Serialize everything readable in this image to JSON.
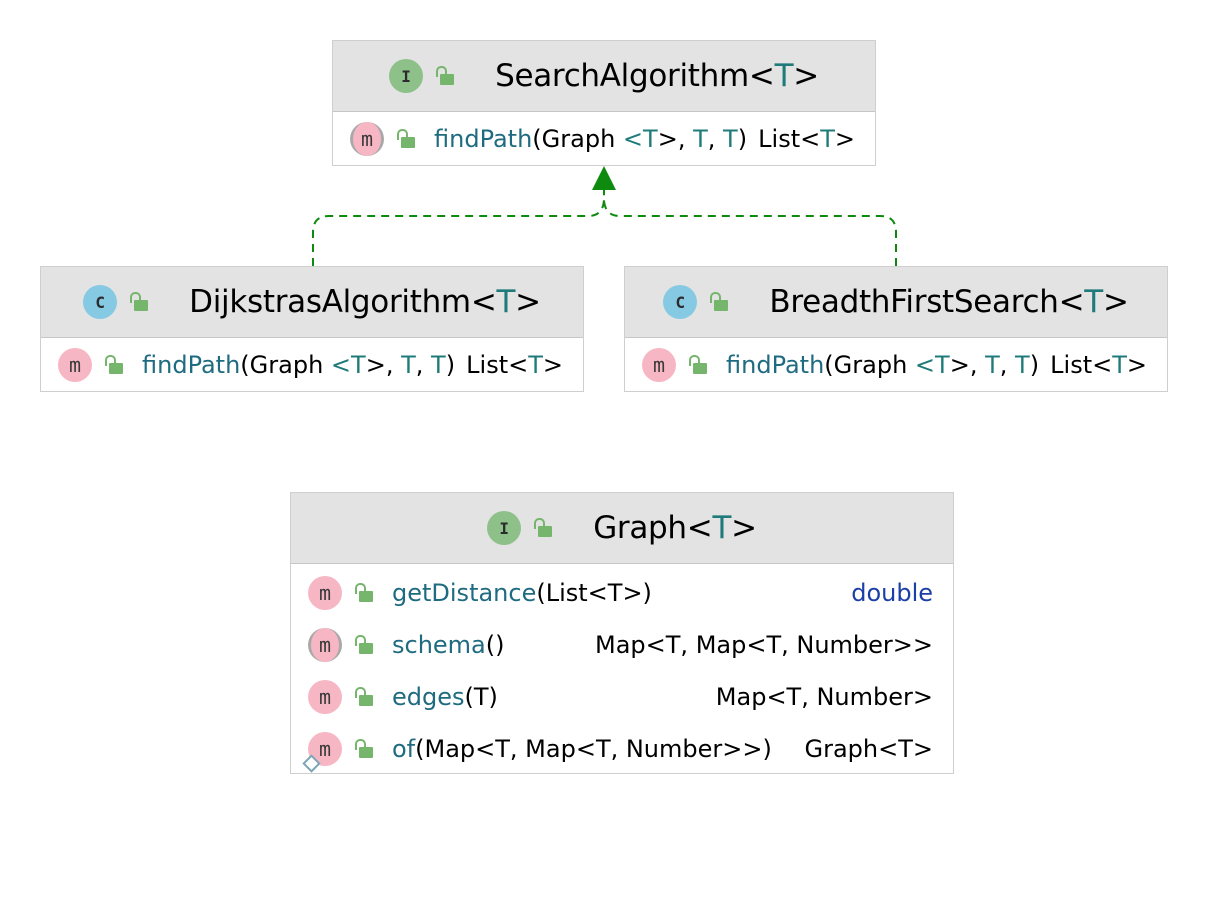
{
  "diagram": {
    "search_algorithm": {
      "kind_icon": "I",
      "title": "SearchAlgorithm",
      "type_param": "T",
      "methods": [
        {
          "icon": "m",
          "abstract": true,
          "name": "findPath",
          "sig_open": "(Graph",
          "lt": "<",
          "t1": "T",
          "gt_comma": ">, ",
          "t2": "T",
          "comma": ", ",
          "t3": "T",
          "close": ")",
          "ret_text": "List",
          "ret_lt": "<",
          "ret_t": "T",
          "ret_gt": ">"
        }
      ]
    },
    "dijkstras_algorithm": {
      "kind_icon": "C",
      "title": "DijkstrasAlgorithm",
      "type_param": "T",
      "methods": [
        {
          "icon": "m",
          "name": "findPath",
          "sig_open": "(Graph",
          "lt": "<",
          "t1": "T",
          "gt_comma": ">, ",
          "t2": "T",
          "comma": ", ",
          "t3": "T",
          "close": ")",
          "ret_text": "List",
          "ret_lt": "<",
          "ret_t": "T",
          "ret_gt": ">"
        }
      ]
    },
    "breadth_first_search": {
      "kind_icon": "C",
      "title": "BreadthFirstSearch",
      "type_param": "T",
      "methods": [
        {
          "icon": "m",
          "name": "findPath",
          "sig_open": "(Graph",
          "lt": "<",
          "t1": "T",
          "gt_comma": ">, ",
          "t2": "T",
          "comma": ", ",
          "t3": "T",
          "close": ")",
          "ret_text": "List",
          "ret_lt": "<",
          "ret_t": "T",
          "ret_gt": ">"
        }
      ]
    },
    "graph": {
      "kind_icon": "I",
      "title": "Graph",
      "type_param": "T",
      "methods": [
        {
          "icon": "m",
          "name": "getDistance",
          "params": "(List<T>)",
          "ret": "double"
        },
        {
          "icon": "m",
          "abstract": true,
          "name": "schema",
          "params": "()",
          "ret": "Map<T, Map<T, Number>>"
        },
        {
          "icon": "m",
          "name": "edges",
          "params": "(T)",
          "ret": "Map<T, Number>"
        },
        {
          "icon": "m",
          "static": true,
          "name": "of",
          "params": "(Map<T, Map<T, Number>>)",
          "ret": "Graph<T>"
        }
      ]
    },
    "colors": {
      "interface_icon": "#8ec18a",
      "class_icon": "#85c9e3",
      "method_icon": "#f7b6c3",
      "lock_icon": "#76b56c",
      "header_bg": "#e3e3e3",
      "type_param": "#1f7a7a",
      "method_name": "#1f6b80",
      "keyword": "#1b3fa6",
      "realization_arrow": "#0e8a0e"
    },
    "relations": [
      {
        "from": "DijkstrasAlgorithm",
        "to": "SearchAlgorithm",
        "type": "realization"
      },
      {
        "from": "BreadthFirstSearch",
        "to": "SearchAlgorithm",
        "type": "realization"
      }
    ]
  }
}
